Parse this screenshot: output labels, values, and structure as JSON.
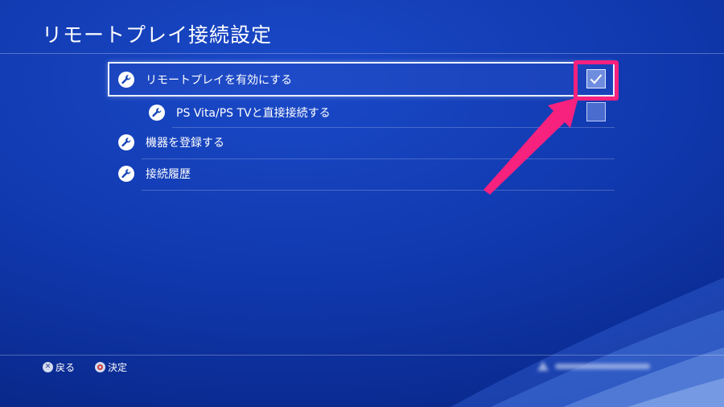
{
  "page": {
    "title": "リモートプレイ接続設定"
  },
  "menu": {
    "items": [
      {
        "label": "リモートプレイを有効にする",
        "checked": true
      },
      {
        "label": "PS Vita/PS TVと直接接続する",
        "checked": false
      },
      {
        "label": "機器を登録する"
      },
      {
        "label": "接続履歴"
      }
    ]
  },
  "footer": {
    "back_label": "戻る",
    "confirm_label": "決定"
  },
  "colors": {
    "background": "#1038ad",
    "highlight": "#f7217e",
    "icon": "#ffffff"
  },
  "icons": {
    "menu_item": "wrench-icon",
    "checkbox": "check-icon",
    "back_button": "cross-button-icon",
    "confirm_button": "circle-button-icon"
  }
}
